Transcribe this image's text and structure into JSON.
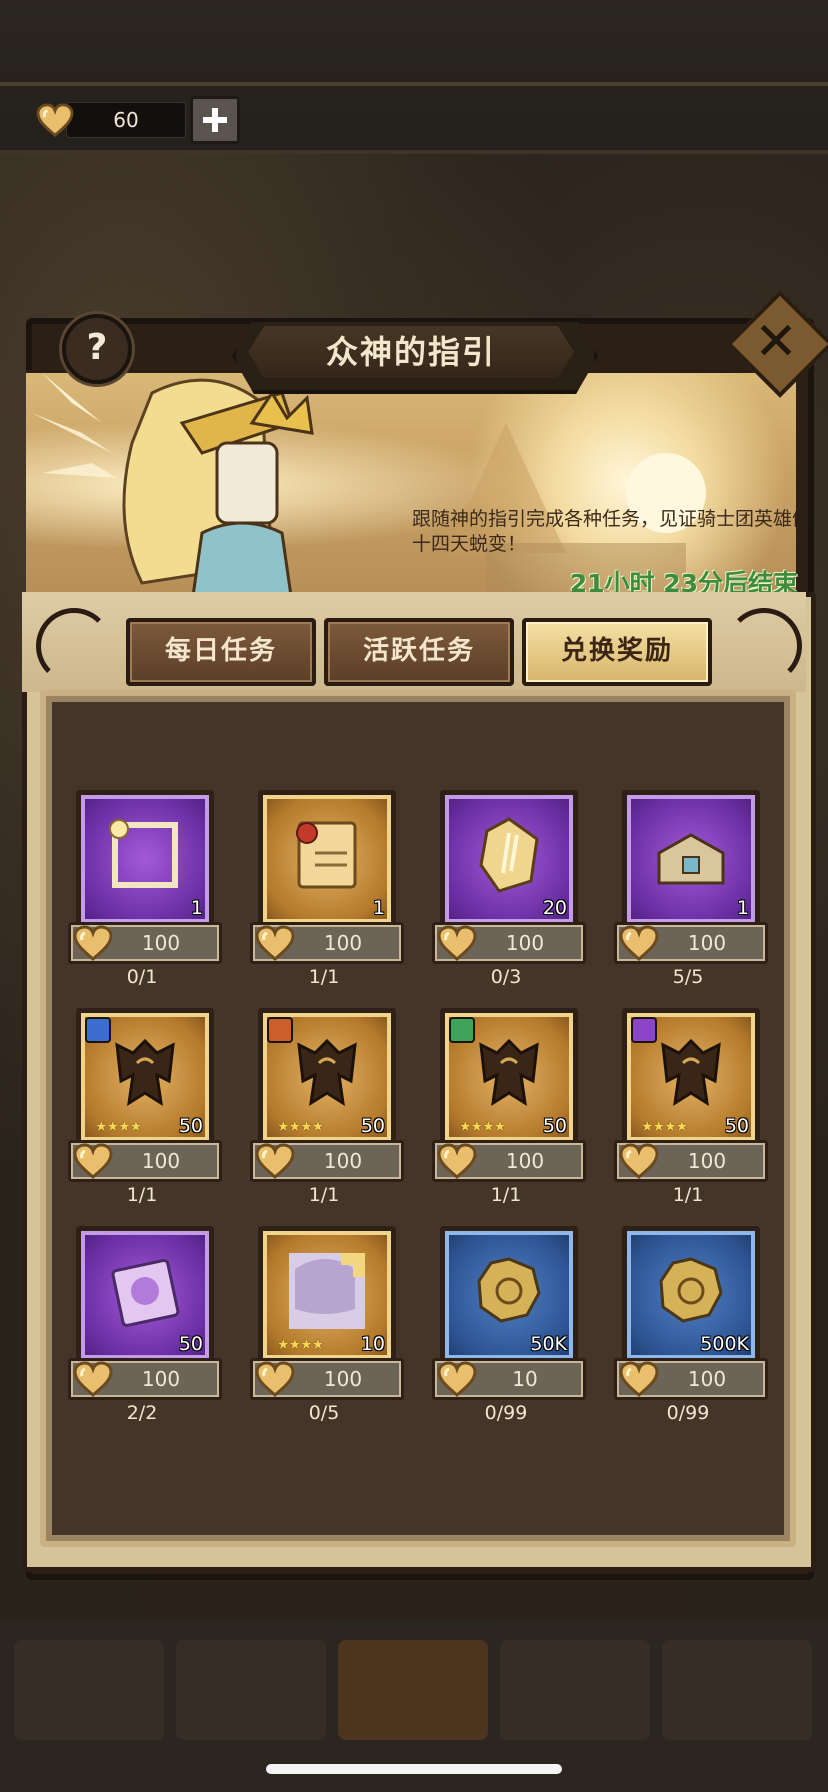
{
  "currency": {
    "amount": "60"
  },
  "title": "众神的指引",
  "banner": {
    "description": "跟随神的指引完成各种任务，见证骑士团英雄们的十四天蜕变！",
    "timer": "21小时 23分后结束"
  },
  "tabs": [
    {
      "label": "每日任务",
      "active": false
    },
    {
      "label": "活跃任务",
      "active": false
    },
    {
      "label": "兑换奖励",
      "active": true
    }
  ],
  "items": [
    {
      "icon": "frame-icon",
      "rarity": "purple",
      "count": "1",
      "price": "100",
      "progress": "0/1"
    },
    {
      "icon": "scroll-icon",
      "rarity": "gold",
      "count": "1",
      "price": "100",
      "progress": "1/1"
    },
    {
      "icon": "crystal-icon",
      "rarity": "purple",
      "count": "20",
      "price": "100",
      "progress": "0/3"
    },
    {
      "icon": "chest-icon",
      "rarity": "purple",
      "count": "1",
      "price": "100",
      "progress": "5/5"
    },
    {
      "icon": "hero-shard-icon",
      "rarity": "gold",
      "count": "50",
      "stars": "★★★★",
      "badge": "#3a6fd1",
      "price": "100",
      "progress": "1/1"
    },
    {
      "icon": "hero-shard-icon",
      "rarity": "gold",
      "count": "50",
      "stars": "★★★★",
      "badge": "#c9602c",
      "price": "100",
      "progress": "1/1"
    },
    {
      "icon": "hero-shard-icon",
      "rarity": "gold",
      "count": "50",
      "stars": "★★★★",
      "badge": "#3fa35a",
      "price": "100",
      "progress": "1/1"
    },
    {
      "icon": "hero-shard-icon",
      "rarity": "gold",
      "count": "50",
      "stars": "★★★★",
      "badge": "#8a45c9",
      "price": "100",
      "progress": "1/1"
    },
    {
      "icon": "card-pack-icon",
      "rarity": "purple",
      "count": "50",
      "price": "100",
      "progress": "2/2"
    },
    {
      "icon": "portrait-shard-icon",
      "rarity": "gold",
      "count": "10",
      "stars": "★★★★",
      "price": "100",
      "progress": "0/5"
    },
    {
      "icon": "gold-coin-icon",
      "rarity": "blue",
      "count": "50K",
      "price": "10",
      "progress": "0/99"
    },
    {
      "icon": "gold-coin-icon",
      "rarity": "blue",
      "count": "500K",
      "price": "100",
      "progress": "0/99"
    }
  ]
}
